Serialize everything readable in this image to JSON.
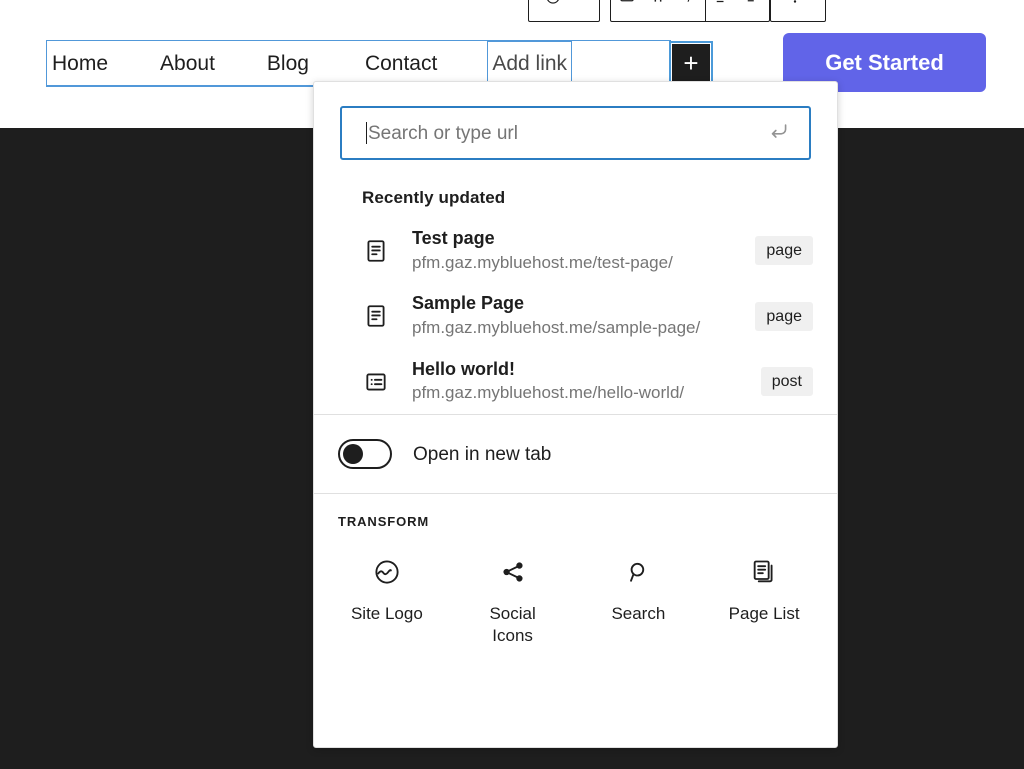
{
  "toolbar": {
    "groups": [
      {
        "name": "block-type-group",
        "buttons": [
          {
            "icon": "circle-icon",
            "glyph": "◠"
          }
        ]
      },
      {
        "name": "formatting-group",
        "buttons": [
          {
            "icon": "link-icon",
            "glyph": "▭"
          },
          {
            "icon": "bold-icon",
            "glyph": "ıı"
          },
          {
            "icon": "italic-icon",
            "glyph": "⁄"
          },
          {
            "icon": "align-icon",
            "glyph": "≡"
          },
          {
            "icon": "list-icon",
            "glyph": "⊒"
          }
        ]
      },
      {
        "name": "more-options-group",
        "buttons": [
          {
            "icon": "more-vertical-icon",
            "glyph": "⋮"
          }
        ]
      }
    ]
  },
  "navigation": {
    "items": [
      {
        "label": "Home",
        "name": "nav-item-home"
      },
      {
        "label": "About",
        "name": "nav-item-about"
      },
      {
        "label": "Blog",
        "name": "nav-item-blog"
      },
      {
        "label": "Contact",
        "name": "nav-item-contact"
      }
    ],
    "add_link_label": "Add link",
    "appender_label": "+",
    "cta_label": "Get Started",
    "selection_color": "#5198d9",
    "cta_color": "#6164e8"
  },
  "popover": {
    "search": {
      "placeholder": "Search or type url",
      "value": "",
      "submit_icon": "enter-return-icon"
    },
    "recently_updated_title": "Recently updated",
    "results": [
      {
        "title": "Test page",
        "url": "pfm.gaz.mybluehost.me/test-page/",
        "badge": "page",
        "icon": "page-document-icon"
      },
      {
        "title": "Sample Page",
        "url": "pfm.gaz.mybluehost.me/sample-page/",
        "badge": "page",
        "icon": "page-document-icon"
      },
      {
        "title": "Hello world!",
        "url": "pfm.gaz.mybluehost.me/hello-world/",
        "badge": "post",
        "icon": "post-list-icon"
      }
    ],
    "open_new_tab": {
      "label": "Open in new tab",
      "enabled": false
    },
    "transform": {
      "title": "Transform",
      "options": [
        {
          "label": "Site Logo",
          "icon": "site-logo-icon"
        },
        {
          "label": "Social Icons",
          "icon": "share-icon"
        },
        {
          "label": "Search",
          "icon": "search-icon"
        },
        {
          "label": "Page List",
          "icon": "page-list-icon"
        }
      ]
    }
  }
}
